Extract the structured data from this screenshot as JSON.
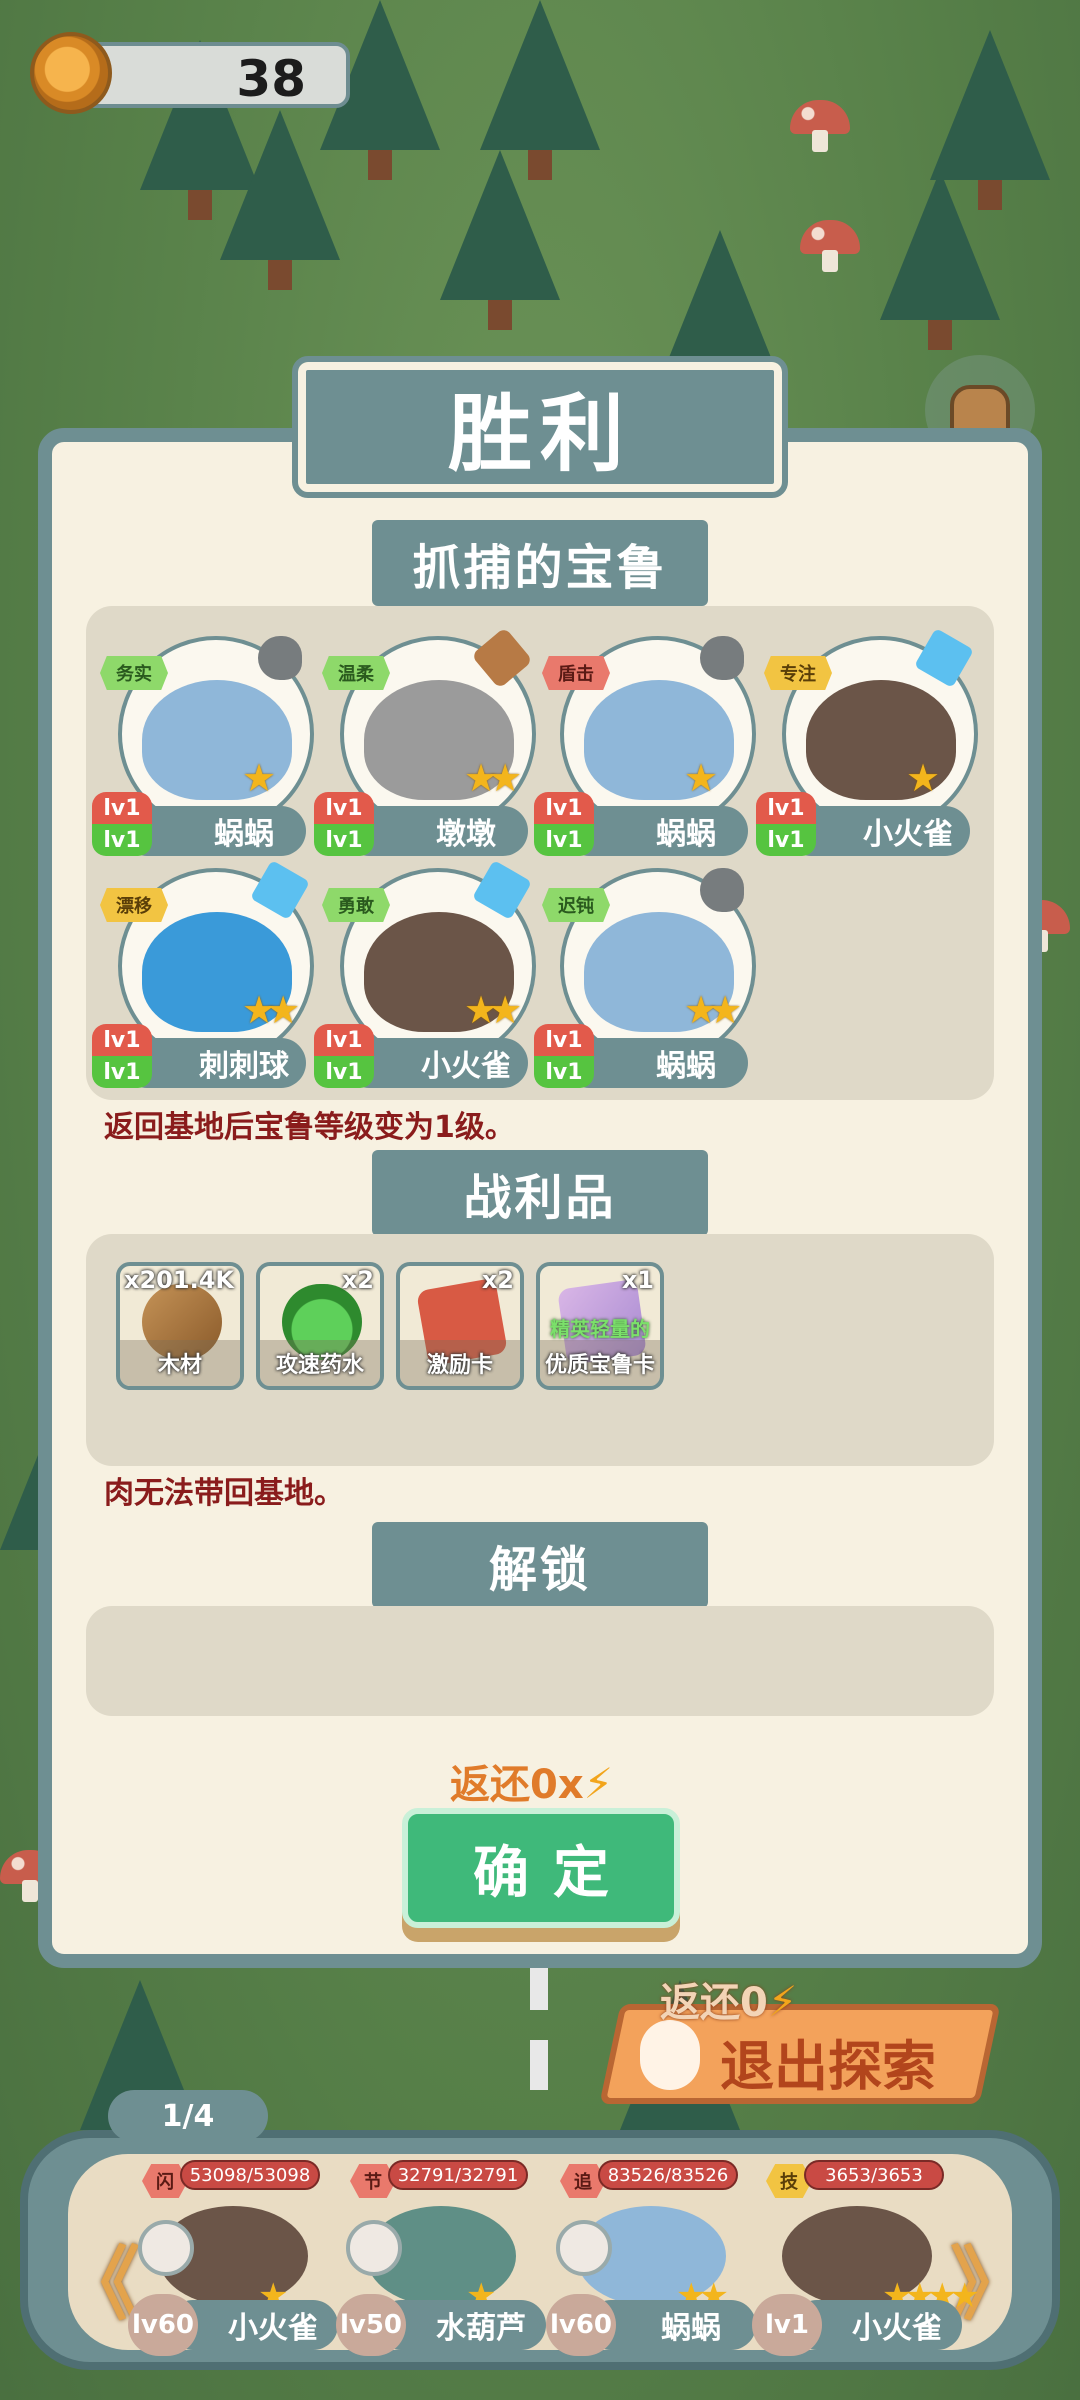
{
  "hud": {
    "coins": "38"
  },
  "result": {
    "title": "胜利",
    "captured_header": "抓捕的宝鲁",
    "captured_note": "返回基地后宝鲁等级变为1级。",
    "loot_header": "战利品",
    "loot_note": "肉无法带回基地。",
    "unlock_header": "解锁",
    "refund_text": "返还0x",
    "confirm_label": "确定"
  },
  "captured_pets": [
    {
      "name": "蜗蜗",
      "trait": "务实",
      "level_top": "lv1",
      "level_bottom": "lv1",
      "stars": "★",
      "resource": "rock"
    },
    {
      "name": "墩墩",
      "trait": "温柔",
      "level_top": "lv1",
      "level_bottom": "lv1",
      "stars": "★★",
      "resource": "log"
    },
    {
      "name": "蜗蜗",
      "trait": "盾击",
      "level_top": "lv1",
      "level_bottom": "lv1",
      "stars": "★",
      "resource": "rock"
    },
    {
      "name": "小火雀",
      "trait": "专注",
      "level_top": "lv1",
      "level_bottom": "lv1",
      "stars": "★",
      "resource": "crystal"
    },
    {
      "name": "刺刺球",
      "trait": "漂移",
      "level_top": "lv1",
      "level_bottom": "lv1",
      "stars": "★★",
      "resource": "crystal"
    },
    {
      "name": "小火雀",
      "trait": "勇敢",
      "level_top": "lv1",
      "level_bottom": "lv1",
      "stars": "★★",
      "resource": "crystal"
    },
    {
      "name": "蜗蜗",
      "trait": "迟钝",
      "level_top": "lv1",
      "level_bottom": "lv1",
      "stars": "★★",
      "resource": "rock"
    }
  ],
  "loot_items": [
    {
      "label": "木材",
      "count": "x201.4K",
      "sublabel": ""
    },
    {
      "label": "攻速药水",
      "count": "x2",
      "sublabel": ""
    },
    {
      "label": "激励卡",
      "count": "x2",
      "sublabel": ""
    },
    {
      "label": "优质宝鲁卡",
      "count": "x1",
      "sublabel": "精英轻量的"
    }
  ],
  "exit": {
    "refund_text": "返还0",
    "label": "退出探索"
  },
  "team": {
    "page": "1/4",
    "members": [
      {
        "tag": "闪",
        "hp": "53098/53098",
        "level": "lv60",
        "name": "小火雀",
        "stars": "★"
      },
      {
        "tag": "节",
        "hp": "32791/32791",
        "level": "lv50",
        "name": "水葫芦",
        "stars": "★"
      },
      {
        "tag": "追",
        "hp": "83526/83526",
        "level": "lv60",
        "name": "蜗蜗",
        "stars": "★★"
      },
      {
        "tag": "技",
        "hp": "3653/3653",
        "level": "lv1",
        "name": "小火雀",
        "stars": "★★★★"
      }
    ],
    "prev_arrow": "《",
    "next_arrow": "》"
  },
  "colors": {
    "panel_border": "#6e8f92",
    "panel_bg": "#f7f1e1",
    "confirm": "#3fb97a",
    "note_red": "#8a1c1c"
  }
}
